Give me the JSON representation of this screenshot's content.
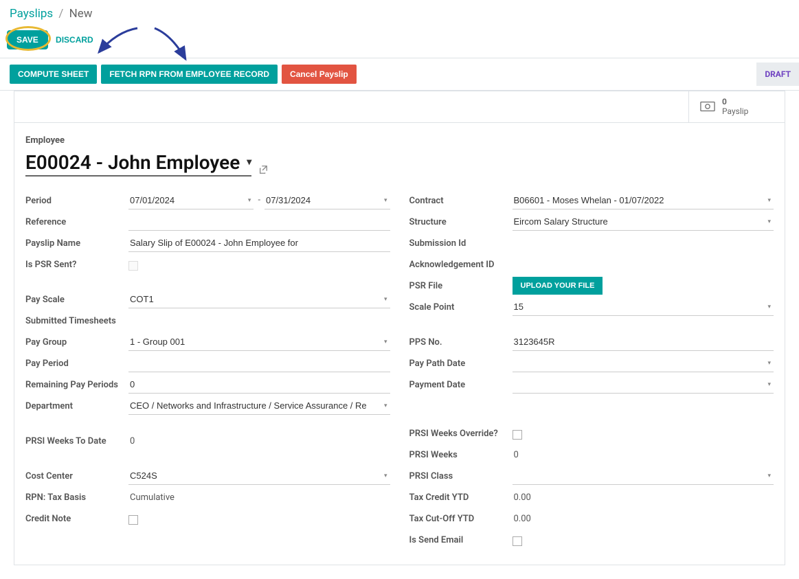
{
  "breadcrumb": {
    "root": "Payslips",
    "current": "New"
  },
  "buttons": {
    "save": "SAVE",
    "discard": "DISCARD",
    "compute": "COMPUTE SHEET",
    "fetch_rpn": "FETCH RPN FROM EMPLOYEE RECORD",
    "cancel_payslip": "Cancel Payslip",
    "upload": "UPLOAD YOUR FILE"
  },
  "status": "DRAFT",
  "stat": {
    "count": "0",
    "label": "Payslip"
  },
  "employee": {
    "label": "Employee",
    "value": "E00024 - John Employee"
  },
  "left": {
    "period_label": "Period",
    "period_from": "07/01/2024",
    "period_to": "07/31/2024",
    "reference_label": "Reference",
    "reference": "",
    "payslip_name_label": "Payslip Name",
    "payslip_name": "Salary Slip of E00024 - John Employee for",
    "is_psr_sent_label": "Is PSR Sent?",
    "pay_scale_label": "Pay Scale",
    "pay_scale": "COT1",
    "submitted_ts_label": "Submitted Timesheets",
    "pay_group_label": "Pay Group",
    "pay_group": "1 - Group 001",
    "pay_period_label": "Pay Period",
    "pay_period": "",
    "remaining_label": "Remaining Pay Periods",
    "remaining": "0",
    "department_label": "Department",
    "department": "CEO / Networks and Infrastructure / Service Assurance / Re",
    "prsi_wtd_label": "PRSI Weeks To Date",
    "prsi_wtd": "0",
    "cost_center_label": "Cost Center",
    "cost_center": "C524S",
    "rpn_basis_label": "RPN: Tax Basis",
    "rpn_basis": "Cumulative",
    "credit_note_label": "Credit Note"
  },
  "right": {
    "contract_label": "Contract",
    "contract": "B06601 - Moses Whelan - 01/07/2022",
    "structure_label": "Structure",
    "structure": "Eircom Salary Structure",
    "submission_id_label": "Submission Id",
    "ack_id_label": "Acknowledgement ID",
    "psr_file_label": "PSR File",
    "scale_point_label": "Scale Point",
    "scale_point": "15",
    "pps_label": "PPS No.",
    "pps": "3123645R",
    "paypath_label": "Pay Path Date",
    "paypath": "",
    "payment_date_label": "Payment Date",
    "payment_date": "",
    "prsi_override_label": "PRSI Weeks Override?",
    "prsi_weeks_label": "PRSI Weeks",
    "prsi_weeks": "0",
    "prsi_class_label": "PRSI Class",
    "prsi_class": "",
    "tax_credit_label": "Tax Credit YTD",
    "tax_credit": "0.00",
    "tax_cutoff_label": "Tax Cut-Off YTD",
    "tax_cutoff": "0.00",
    "send_email_label": "Is Send Email"
  }
}
